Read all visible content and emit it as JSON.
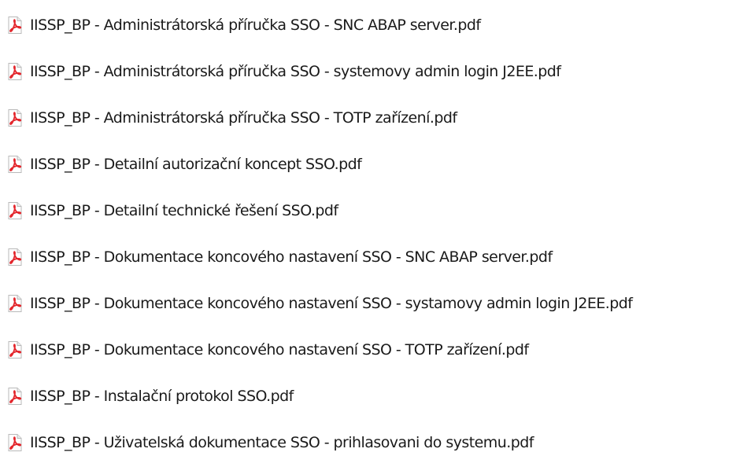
{
  "file_list": {
    "icon": "pdf-file-icon",
    "icon_color": "#e3262c",
    "items": [
      {
        "name": "IISSP_BP - Administrátorská příručka SSO - SNC ABAP server.pdf"
      },
      {
        "name": "IISSP_BP - Administrátorská příručka SSO - systemovy admin login J2EE.pdf"
      },
      {
        "name": "IISSP_BP - Administrátorská příručka SSO - TOTP zařízení.pdf"
      },
      {
        "name": "IISSP_BP - Detailní autorizační koncept SSO.pdf"
      },
      {
        "name": "IISSP_BP - Detailní technické řešení SSO.pdf"
      },
      {
        "name": "IISSP_BP - Dokumentace koncového nastavení SSO - SNC ABAP server.pdf"
      },
      {
        "name": "IISSP_BP - Dokumentace koncového nastavení SSO - systamovy admin login J2EE.pdf"
      },
      {
        "name": "IISSP_BP - Dokumentace koncového nastavení SSO - TOTP zařízení.pdf"
      },
      {
        "name": "IISSP_BP - Instalační protokol SSO.pdf"
      },
      {
        "name": "IISSP_BP - Uživatelská dokumentace SSO - prihlasovani do systemu.pdf"
      }
    ]
  }
}
